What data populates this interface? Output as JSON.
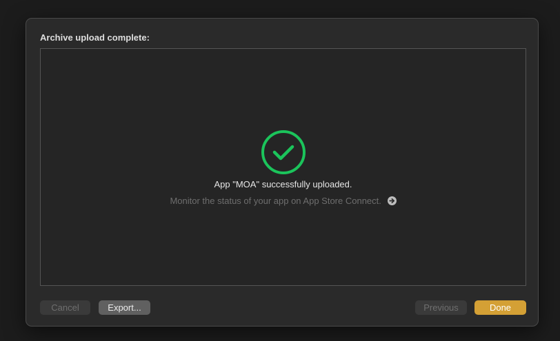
{
  "dialog": {
    "title": "Archive upload complete:",
    "status_message": "App \"MOA\" successfully uploaded.",
    "monitor_text": "Monitor the status of your app on App Store Connect.",
    "success_icon": "checkmark-circle-icon",
    "link_icon": "arrow-right-circle-icon"
  },
  "buttons": {
    "cancel": "Cancel",
    "export": "Export...",
    "previous": "Previous",
    "done": "Done"
  },
  "colors": {
    "success": "#1bc45b",
    "accent": "#d4a035"
  }
}
